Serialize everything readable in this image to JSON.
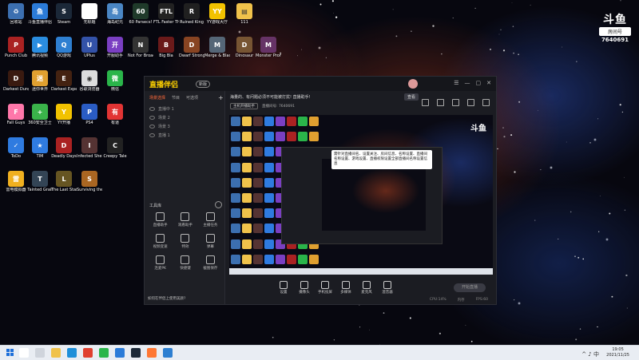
{
  "desktop": {
    "icons": [
      {
        "label": "回收站",
        "name": "recycle-bin-icon",
        "color": "#3c6fb0",
        "glyph": "♻"
      },
      {
        "label": "斗鱼直播伴侣",
        "name": "douyu-icon",
        "color": "#2b7bd8",
        "glyph": "鱼"
      },
      {
        "label": "Steam",
        "name": "steam-icon",
        "color": "#1b2838",
        "glyph": "S"
      },
      {
        "label": "无标题",
        "name": "untitled-icon",
        "color": "#ffffff",
        "glyph": ""
      },
      {
        "label": "海岛纪元",
        "name": "island-icon",
        "color": "#4a86c4",
        "glyph": "岛"
      },
      {
        "label": "60 Parsecs!",
        "name": "60-parsecs-icon",
        "color": "#1f3a2a",
        "glyph": "60"
      },
      {
        "label": "FTL Faster Than Light",
        "name": "ftl-icon",
        "color": "#222222",
        "glyph": "FTL"
      },
      {
        "label": "Ruined King",
        "name": "ruined-king-icon",
        "color": "#202020",
        "glyph": "R"
      },
      {
        "label": "YY游戏大厅",
        "name": "yy-icon",
        "color": "#f2c200",
        "glyph": "YY"
      },
      {
        "label": "111",
        "name": "folder-111-icon",
        "color": "#f0c24b",
        "glyph": "▤"
      },
      {
        "label": "Punch Club",
        "name": "punch-club-icon",
        "color": "#aa2222",
        "glyph": "P"
      },
      {
        "label": "腾讯视频",
        "name": "tencent-video-icon",
        "color": "#2a8de0",
        "glyph": "▶"
      },
      {
        "label": "QQ游戏",
        "name": "qq-game-icon",
        "color": "#2e7fd1",
        "glyph": "Q"
      },
      {
        "label": "UPlus",
        "name": "uplus-icon",
        "color": "#3352a8",
        "glyph": "U"
      },
      {
        "label": "开服助手",
        "name": "server-helper-icon",
        "color": "#7a3fc2",
        "glyph": "开"
      },
      {
        "label": "Not For Broadcast",
        "name": "not-for-broadcast-icon",
        "color": "#333333",
        "glyph": "N"
      },
      {
        "label": "Big Bla",
        "name": "big-bla-icon",
        "color": "#6a1a1a",
        "glyph": "B"
      },
      {
        "label": "Dwarf Stronghold",
        "name": "dwarf-icon",
        "color": "#884422",
        "glyph": "D"
      },
      {
        "label": "Merge & Blade",
        "name": "merge-blade-icon",
        "color": "#556677",
        "glyph": "M"
      },
      {
        "label": "Dinosaur",
        "name": "dinosaur-icon",
        "color": "#775533",
        "glyph": "D"
      },
      {
        "label": "Monster Prom",
        "name": "monster-prom-icon",
        "color": "#663366",
        "glyph": "M"
      },
      {
        "label": "Darkest Dungeon",
        "name": "darkest-dungeon-icon",
        "color": "#3a1a10",
        "glyph": "D"
      },
      {
        "label": "迷你世界",
        "name": "mini-world-icon",
        "color": "#e0a030",
        "glyph": "迷"
      },
      {
        "label": "Darkest Expedition",
        "name": "darkest-expedition-icon",
        "color": "#442211",
        "glyph": "E"
      },
      {
        "label": "谷歌浏览器",
        "name": "chrome-icon",
        "color": "#dddddd",
        "glyph": "◉"
      },
      {
        "label": "微信",
        "name": "wechat-icon",
        "color": "#2ab54a",
        "glyph": "微"
      },
      {
        "label": "Fall Guys",
        "name": "fall-guys-icon",
        "color": "#ff77aa",
        "glyph": "F"
      },
      {
        "label": "360安全卫士",
        "name": "360-safe-icon",
        "color": "#3ab34a",
        "glyph": "+"
      },
      {
        "label": "YY开播",
        "name": "yy-live-icon",
        "color": "#f2c200",
        "glyph": "Y"
      },
      {
        "label": "PS4",
        "name": "ps4-icon",
        "color": "#2a5cc4",
        "glyph": "P"
      },
      {
        "label": "有道",
        "name": "youdao-icon",
        "color": "#e23434",
        "glyph": "有"
      },
      {
        "label": "ToDo",
        "name": "todo-icon",
        "color": "#2f7be0",
        "glyph": "✓"
      },
      {
        "label": "TIM",
        "name": "tim-icon",
        "color": "#2f7be0",
        "glyph": "★"
      },
      {
        "label": "Deadly Days",
        "name": "deadly-days-icon",
        "color": "#aa2222",
        "glyph": "D"
      },
      {
        "label": "Infected Shelter",
        "name": "infected-icon",
        "color": "#553333",
        "glyph": "I"
      },
      {
        "label": "Creepy Tale",
        "name": "creepy-icon",
        "color": "#222222",
        "glyph": "C"
      },
      {
        "label": "雷电模拟器",
        "name": "ldplayer-icon",
        "color": "#f0b020",
        "glyph": "雷"
      },
      {
        "label": "Tainted Grail",
        "name": "tainted-grail-icon",
        "color": "#334455",
        "glyph": "T"
      },
      {
        "label": "The Last Stand",
        "name": "last-stand-icon",
        "color": "#665522",
        "glyph": "L"
      },
      {
        "label": "Surviving the Aftermath",
        "name": "surviving-icon",
        "color": "#aa6622",
        "glyph": "S"
      }
    ]
  },
  "watermark": {
    "logo": "斗鱼",
    "sub": "房间号",
    "id": "7640691"
  },
  "app": {
    "title": "直播伴侣",
    "badge": "新版",
    "window_controls": [
      "☰",
      "—",
      "▢",
      "✕"
    ],
    "sidebar": {
      "tabs": [
        "场景选择",
        "节目",
        "可选项"
      ],
      "scenes": [
        "直播中 1",
        "场景 2",
        "场景 3",
        "直播 1"
      ],
      "tools_label": "工具库",
      "tools": [
        "直播助手",
        "观看助手",
        "主播任务",
        "视频变速",
        "特效",
        "弹幕",
        "连麦PK",
        "快捷键",
        "截图保存"
      ],
      "footer": "如何在伴侣上使用美颜?"
    },
    "main": {
      "notice": "海量的、有问题必须不可能被打扰! 直播助手!",
      "notice_button": "查看",
      "stream_chip": "主机开播助手",
      "stream_meta": [
        "直播间号: 7640691"
      ],
      "preview_watermark": "斗鱼",
      "tooltip": "需针对直播间名、设置关注、房间信息、名称设置、直播间名称设置、游戏设置、直播权限设置全部直播间名称设置信息",
      "bottom_items": [
        "设置",
        "摄像头",
        "手机投屏",
        "多媒体",
        "麦克风",
        "混音器"
      ],
      "go_live": "开始直播",
      "stats": [
        "CPU:14%",
        "内存",
        "FPS:60"
      ]
    }
  },
  "taskbar": {
    "apps": [
      {
        "name": "search-app",
        "color": "#ffffff"
      },
      {
        "name": "task-view-app",
        "color": "#cfd4dc"
      },
      {
        "name": "explorer-app",
        "color": "#f0c24b"
      },
      {
        "name": "edge-app",
        "color": "#1e8fd9"
      },
      {
        "name": "chrome-app",
        "color": "#e04030"
      },
      {
        "name": "wechat-app",
        "color": "#2ab54a"
      },
      {
        "name": "douyu-app",
        "color": "#2b7bd8"
      },
      {
        "name": "steam-app",
        "color": "#1b2838"
      },
      {
        "name": "live-app",
        "color": "#ff7733"
      },
      {
        "name": "store-app",
        "color": "#2d7fd1"
      }
    ],
    "tray": "^ ♪ 中",
    "time": "19:05",
    "date": "2021/11/25"
  }
}
